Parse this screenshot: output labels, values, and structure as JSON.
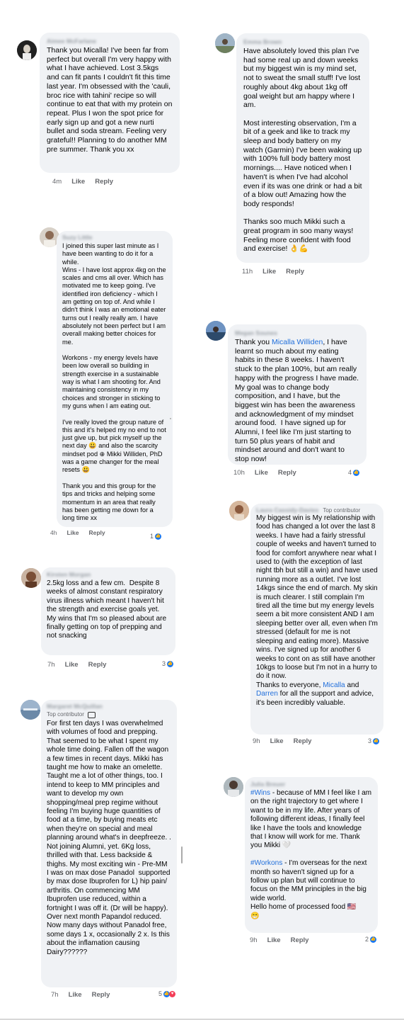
{
  "comments": [
    {
      "id": "c1",
      "author": "Aimee McFarlane",
      "top_contributor": false,
      "text": "Thank you Micalla! I've been far from perfect but overall I'm very happy with what I have achieved. Lost 3.5kgs and can fit pants I couldn't fit this time last year. I'm obsessed with the 'cauli, broc rice with tahini' recipe so will continue to eat that with my protein on repeat. Plus I won the spot price for early sign up and got a new nurti bullet and soda stream. Feeling very grateful!! Planning to do another MM pre summer. Thank you xx",
      "time": "4m",
      "like": "Like",
      "reply": "Reply",
      "reaction_count": ""
    },
    {
      "id": "c2",
      "author": "Emma Brown",
      "top_contributor": false,
      "text": "Have absolutely loved this plan I've had some real up and down weeks but my biggest win is my mind set, not to sweat the small stuff! I've lost roughly about 4kg about 1kg off goal weight but am happy where I am.\n\nMost interesting observation, I'm a bit of a geek and like to track my sleep and body battery on my watch (Garmin) I've been waking up with 100% full body battery most mornings.... Have noticed when I haven't is when I've had alcohol even if its was one drink or had a bit of a blow out! Amazing how the body responds!\n\nThanks soo much Mikki such a great program in soo many ways! Feeling more confident with food and exercise! 👌💪",
      "time": "11h",
      "like": "Like",
      "reply": "Reply",
      "reaction_count": ""
    },
    {
      "id": "c3",
      "author": "Suzy Little",
      "top_contributor": false,
      "text": "I joined this super last minute as I have been wanting to do it for a while.\nWins - I have lost approx 4kg on the scales and cms all over. Which has motivated me to keep going. I've identified iron deficiency - which I am getting on top of. And while I didn't think I was an emotional eater turns out I really really am. I have absolutely not been perfect but I am overall making better choices for me.\n\nWorkons - my energy levels have been low overall so building in strength exercise in a sustainable way is what I am shooting for. And maintaining consistency in my choices and stronger in sticking to my guns when I am eating out.\n\nI've really loved the group nature of this and it's helped my no end to not just give up, but pick myself up the next day 😃 and also the scarcity mindset pod ⊕ Mikki Williden, PhD was a game changer for the meal resets 😃\n\nThank you and this group for the tips and tricks and helping some momentum in an area that really has been getting me down for a long time xx",
      "time": "4h",
      "like": "Like",
      "reply": "Reply",
      "reaction_count": "1"
    },
    {
      "id": "c4",
      "author": "Megan Sounes",
      "top_contributor": false,
      "text_before_mention": "Thank you ",
      "mention": "Micalla Williden",
      "text_after_mention": ", I have learnt so much about my eating habits in these 8 weeks. I haven't stuck to the plan 100%, but am really happy with the progress I have made. My goal was to change body composition, and I have, but the biggest win has been the awareness and acknowledgment of my mindset around food.  I have signed up for Alumni, I feel like I'm just starting to turn 50 plus years of habit and mindset around and don't want to stop now!",
      "time": "10h",
      "like": "Like",
      "reply": "Reply",
      "reaction_count": "4"
    },
    {
      "id": "c5",
      "author": "Laura Cassidy-Davies",
      "top_contributor": true,
      "top_contributor_label": "Top contributor",
      "text_before_mention": "My biggest win is My relationship with food has changed a lot over the last 8 weeks. I have had a fairly stressful couple of weeks and haven't turned to  food for comfort anywhere near what I used to (with the exception of last night tbh but still a win) and have used running more as a outlet. I've lost 14kgs since the end of march. My skin is much clearer. I still complain I'm tired all the time but my energy levels seem a bit more consistent AND I am sleeping better over all, even when I'm stressed (default for me is not sleeping and eating more). Massive wins. I've signed up for another 6 weeks to cont on as still have another 10kgs to loose but I'm not in a hurry to do it now.\nThanks to everyone, ",
      "mention": "Micalla",
      "text_middle": " and\n",
      "mention2": "Darren",
      "text_after_mention": " for all the support and advice, it's been incredibly valuable.",
      "time": "9h",
      "like": "Like",
      "reply": "Reply",
      "reaction_count": "3"
    },
    {
      "id": "c6",
      "author": "Kirsten Morgan",
      "top_contributor": false,
      "text": "2.5kg loss and a few cm.  Despite 8 weeks of almost constant respiratory virus illness which meant I haven't hit the strength and exercise goals yet.\nMy wins that I'm so pleased about are finally getting on top of prepping and not snacking",
      "time": "7h",
      "like": "Like",
      "reply": "Reply",
      "reaction_count": "3"
    },
    {
      "id": "c7",
      "author": "Margaret McQuillan",
      "top_contributor": true,
      "top_contributor_label": "Top contributor",
      "text": "For first ten days I was overwhelmed with volumes of food and prepping. That seemed to be what I spent my whole time doing. Fallen off the wagon a few times in recent days. Mikki has taught me how to make an omelette. Taught me a lot of other things, too. I intend to keep to MM principles and want to develop my own shopping/meal prep regime without feeling I'm buying huge quantities of food at a time, by buying meats etc when they're on special and meal planning around what's in deepfreeze. . Not joining Alumni, yet. 6Kg loss, thrilled with that. Less backside & thighs. My most exciting win - Pre-MM I was on max dose Panadol  supported by max dose Ibuprofen for L) hip pain/ arthritis. On commencing MM Ibuprofen use reduced, within a fortnight I was off it. (Dr will be happy). Over next month Papandol reduced. Now many days without Panadol free, some days 1 x, occasionally 2 x. Is this about the inflamation causing Dairy??????",
      "time": "7h",
      "like": "Like",
      "reply": "Reply",
      "reaction_count": "5"
    },
    {
      "id": "c8",
      "author": "Julia Breuer",
      "top_contributor": false,
      "hashtag1": "#Wins",
      "text1": " - because of MM I feel like I am on the right trajectory to get where I want to be in my life. After years of following different ideas, I finally feel like I have the tools and knowledge that I know will work for me. Thank you Mikki 🤍\n\n",
      "hashtag2": "#Workons",
      "text2": " - I'm overseas for the next month so haven't signed up for a follow up plan but will continue to focus on the MM principles in the big wide world.\nHello home of processed food 🇺🇸\n😁",
      "time": "9h",
      "like": "Like",
      "reply": "Reply",
      "reaction_count": "2"
    }
  ],
  "icons": {
    "like_reaction": "like-icon",
    "love_reaction": "heart-icon",
    "badge": "contributor-badge-icon"
  }
}
